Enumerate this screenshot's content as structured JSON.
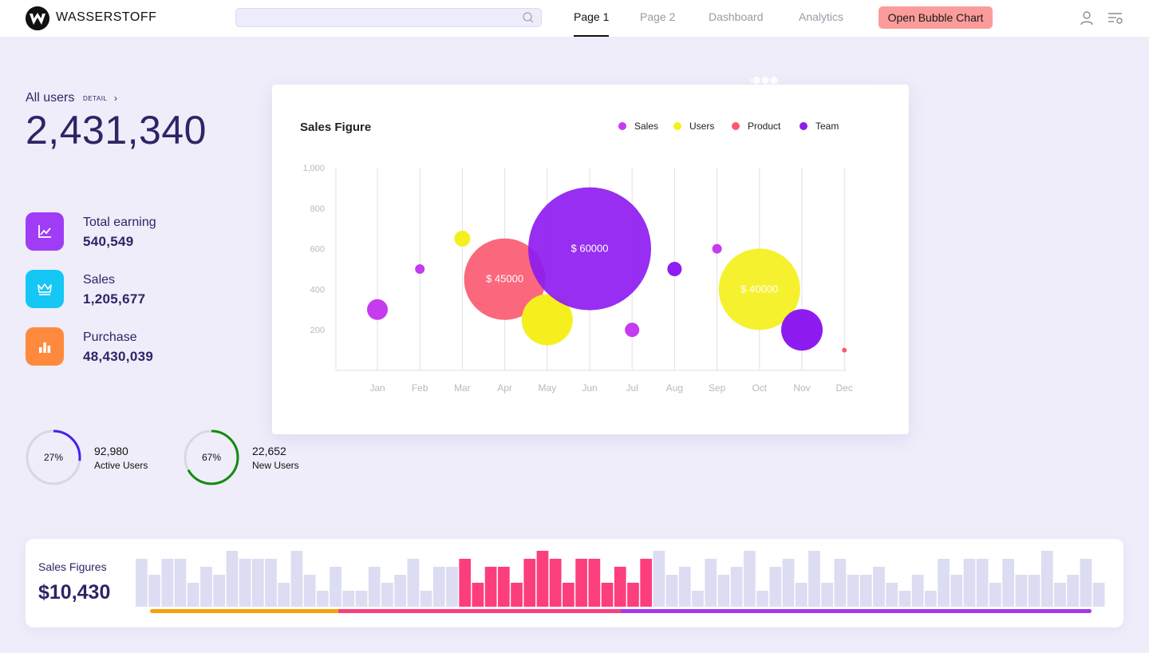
{
  "app": {
    "brand": "WASSERSTOFF"
  },
  "nav": {
    "search_placeholder": "",
    "tabs": [
      {
        "label": "Page 1",
        "active": true
      },
      {
        "label": "Page 2",
        "active": false
      },
      {
        "label": "Dashboard",
        "active": false
      },
      {
        "label": "Analytics",
        "active": false
      }
    ],
    "cta_label": "Open Bubble Chart",
    "icons": [
      "user-icon",
      "filter-settings-icon"
    ]
  },
  "summary": {
    "all_users_label": "All users",
    "detail_label": "DETAIL",
    "detail_chevron": "›",
    "all_users_value": "2,431,340"
  },
  "kpis": [
    {
      "label": "Total earning",
      "value": "540,549",
      "icon": "trend-chart-icon",
      "color": "#a03cf6"
    },
    {
      "label": "Sales",
      "value": "1,205,677",
      "icon": "crown-icon",
      "color": "#14c7f5"
    },
    {
      "label": "Purchase",
      "value": "48,430,039",
      "icon": "bar-chart-icon",
      "color": "#ff8a3d"
    }
  ],
  "rings": [
    {
      "percent_label": "27%",
      "percent": 27,
      "count": "92,980",
      "label": "Active Users",
      "color": "#4a1ef0"
    },
    {
      "percent_label": "67%",
      "percent": 67,
      "count": "22,652",
      "label": "New Users",
      "color": "#138a0e"
    }
  ],
  "bubble_chart": {
    "title": "Sales Figure",
    "legend": [
      {
        "name": "Sales",
        "color": "#c43bf0"
      },
      {
        "name": "Users",
        "color": "#f5f01d"
      },
      {
        "name": "Product",
        "color": "#fb5a72"
      },
      {
        "name": "Team",
        "color": "#8e1cf0"
      }
    ]
  },
  "chart_data": {
    "type": "scatter",
    "subtype": "bubble",
    "title": "Sales Figure",
    "categories": [
      "Jan",
      "Feb",
      "Mar",
      "Apr",
      "May",
      "Jun",
      "Jul",
      "Aug",
      "Sep",
      "Oct",
      "Nov",
      "Dec"
    ],
    "y_ticks": [
      "200",
      "400",
      "600",
      "800",
      "1,000"
    ],
    "ylim": [
      0,
      1000
    ],
    "grid": "vertical",
    "legend_position": "top-right",
    "points": [
      {
        "x": "Jan",
        "y": 300,
        "size": 13,
        "series": "Sales",
        "color": "#c43bf0",
        "label": ""
      },
      {
        "x": "Feb",
        "y": 500,
        "size": 6,
        "series": "Sales",
        "color": "#c43bf0",
        "label": ""
      },
      {
        "x": "Mar",
        "y": 650,
        "size": 10,
        "series": "Users",
        "color": "#f5f01d",
        "label": ""
      },
      {
        "x": "Apr",
        "y": 450,
        "size": 51,
        "series": "Product",
        "color": "#fb5a72",
        "label": "$ 45000"
      },
      {
        "x": "May",
        "y": 250,
        "size": 32,
        "series": "Users",
        "color": "#f5f01d",
        "label": ""
      },
      {
        "x": "Jun",
        "y": 600,
        "size": 77,
        "series": "Team",
        "color": "#8e1cf0",
        "label": "$ 60000"
      },
      {
        "x": "Jul",
        "y": 200,
        "size": 9,
        "series": "Sales",
        "color": "#c43bf0",
        "label": ""
      },
      {
        "x": "Aug",
        "y": 500,
        "size": 9,
        "series": "Team",
        "color": "#8e1cf0",
        "label": ""
      },
      {
        "x": "Sep",
        "y": 600,
        "size": 6,
        "series": "Sales",
        "color": "#c43bf0",
        "label": ""
      },
      {
        "x": "Oct",
        "y": 400,
        "size": 51,
        "series": "Users",
        "color": "#f5f01d",
        "label": "$ 40000"
      },
      {
        "x": "Nov",
        "y": 200,
        "size": 26,
        "series": "Team",
        "color": "#8e1cf0",
        "label": ""
      },
      {
        "x": "Dec",
        "y": 100,
        "size": 3,
        "series": "Product",
        "color": "#fb5a72",
        "label": ""
      }
    ]
  },
  "sales_figures": {
    "label": "Sales Figures",
    "value": "$10,430",
    "bars": [
      50,
      30,
      50,
      50,
      20,
      40,
      30,
      60,
      50,
      50,
      50,
      20,
      60,
      30,
      10,
      40,
      10,
      10,
      40,
      20,
      30,
      50,
      10,
      40,
      40,
      50,
      20,
      40,
      40,
      20,
      50,
      60,
      50,
      20,
      50,
      50,
      20,
      40,
      20,
      50,
      60,
      30,
      40,
      10,
      50,
      30,
      40,
      60,
      10,
      40,
      50,
      20,
      60,
      20,
      50,
      30,
      30,
      40,
      20,
      10,
      30,
      10,
      50,
      30,
      50,
      50,
      20,
      50,
      30,
      30,
      60,
      20,
      30,
      50,
      20
    ],
    "highlight_range": [
      25,
      39
    ],
    "base_color": "#dcdcf2",
    "highlight_color": "#fc3f7c",
    "progress_segments": [
      {
        "fraction": 0.2,
        "color": "#f7a20b"
      },
      {
        "fraction": 0.3,
        "color": "#fc3f7c"
      },
      {
        "fraction": 0.5,
        "color": "#a139f0"
      }
    ]
  }
}
